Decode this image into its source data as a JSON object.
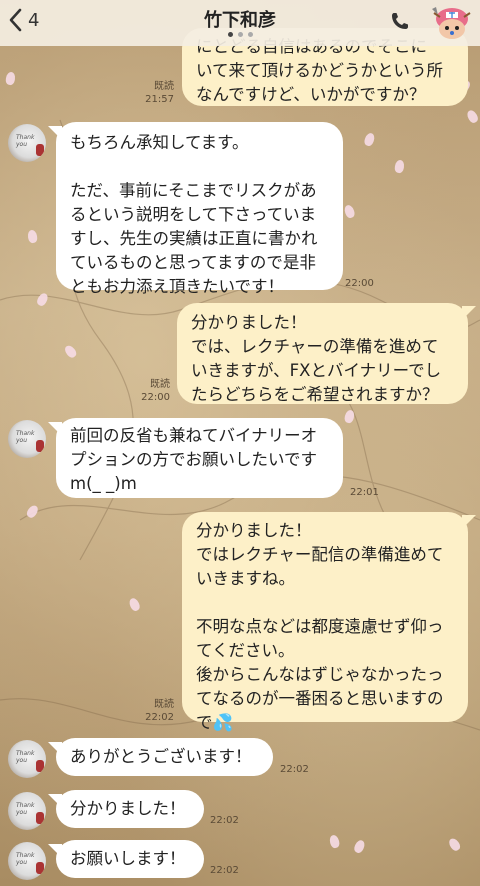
{
  "header": {
    "back_count": "4",
    "title": "竹下和彦"
  },
  "messages": [
    {
      "dir": "out",
      "text": "にとどる自信はあるのでそこに\nいて来て頂けるかどうかという所\nなんですけど、いかがですか？",
      "read": "既読",
      "time": "21:57"
    },
    {
      "dir": "in",
      "text": "もちろん承知してます。\n\nただ、事前にそこまでリスクがあ\nるという説明をして下さっていま\nすし、先生の実績は正直に書かれ\nているものと思ってますので是非\nともお力添え頂きたいです！",
      "time": "22:00"
    },
    {
      "dir": "out",
      "text": "分かりました！\nでは、レクチャーの準備を進めて\nいきますが、FXとバイナリーでし\nたらどちらをご希望されますか？",
      "read": "既読",
      "time": "22:00"
    },
    {
      "dir": "in",
      "text": "前回の反省も兼ねてバイナリーオ\nプションの方でお願いしたいです\nm(_ _)m",
      "time": "22:01"
    },
    {
      "dir": "out",
      "text": "分かりました！\nではレクチャー配信の準備進めて\nいきますね。\n\n不明な点などは都度遠慮せず仰っ\nてください。\n後からこんなはずじゃなかったっ\nてなるのが一番困ると思いますの\nで💦",
      "read": "既読",
      "time": "22:02"
    },
    {
      "dir": "in",
      "text": "ありがとうございます！",
      "time": "22:02"
    },
    {
      "dir": "in",
      "text": "分かりました！",
      "time": "22:02"
    },
    {
      "dir": "in",
      "text": "お願いします！",
      "time": "22:02"
    }
  ]
}
